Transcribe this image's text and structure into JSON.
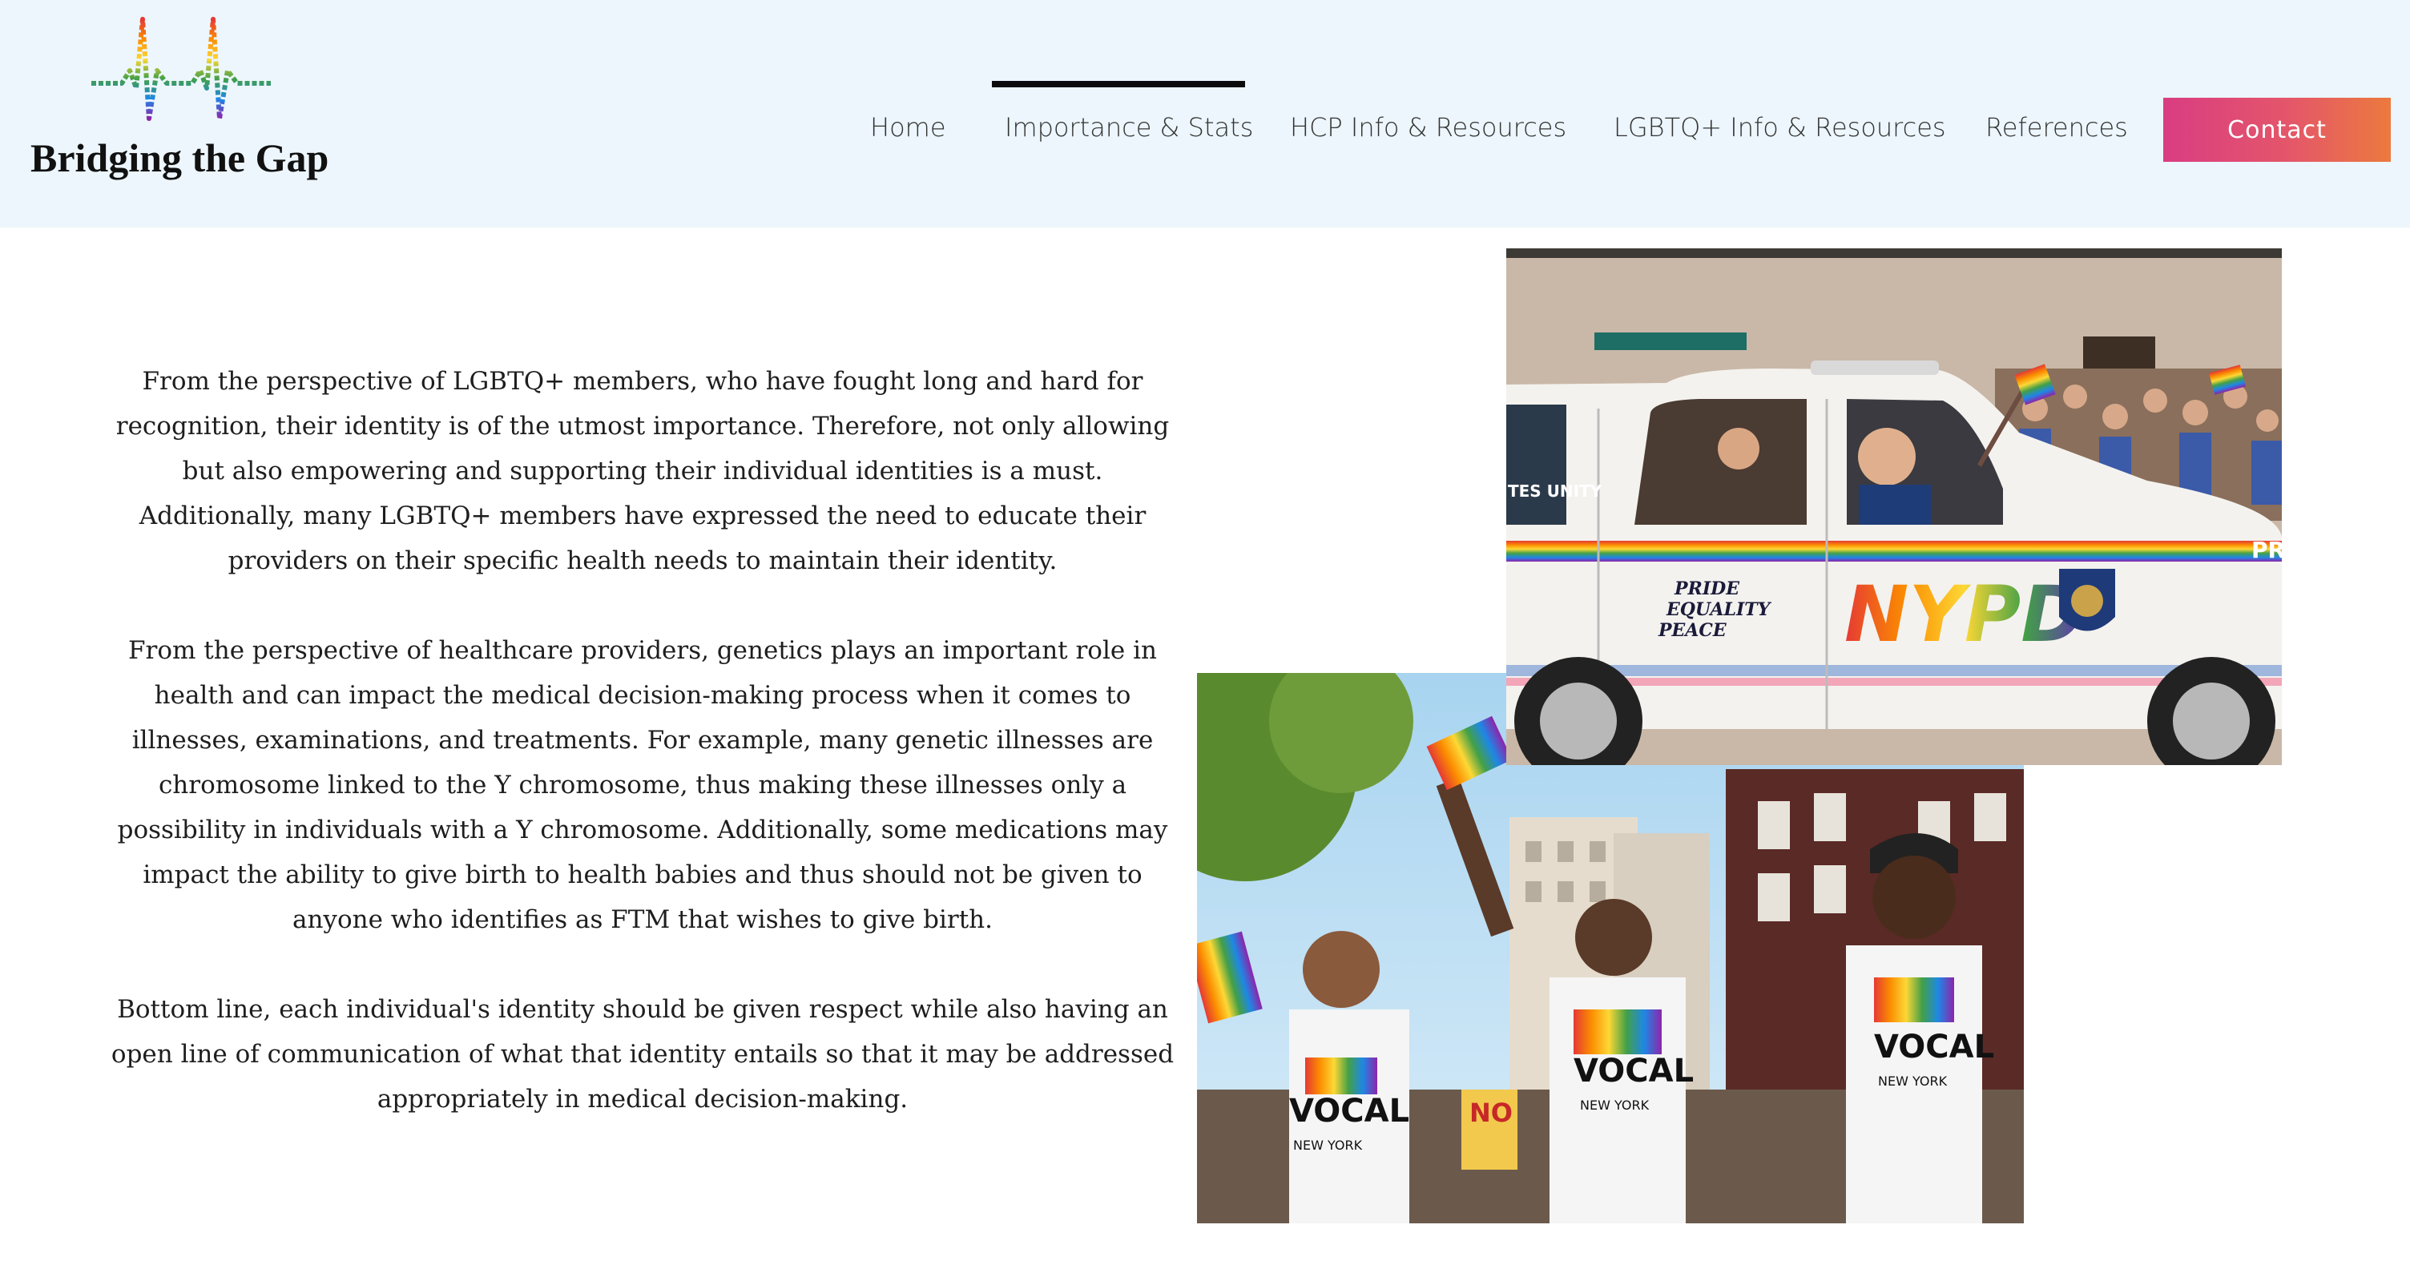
{
  "brand": {
    "name": "Bridging the Gap",
    "logo_icon": "heartbeat-rainbow-icon"
  },
  "nav": {
    "items": [
      {
        "label": "Home",
        "active": false
      },
      {
        "label": "Importance & Stats",
        "active": true
      },
      {
        "label": "HCP Info & Resources",
        "active": false
      },
      {
        "label": "LGBTQ+ Info & Resources",
        "active": false
      },
      {
        "label": "References",
        "active": false
      }
    ],
    "contact_label": "Contact"
  },
  "content": {
    "paragraphs": [
      "From the perspective of LGBTQ+ members, who have fought long and hard for recognition, their identity is of the utmost importance. Therefore, not only allowing but also empowering and supporting their individual identities is a must. Additionally, many LGBTQ+ members have expressed the need to educate their providers on their specific health needs to maintain their identity.",
      "From the perspective of healthcare providers, genetics plays an important role in health and can impact the medical decision-making process when it comes to illnesses, examinations, and treatments. For example, many genetic illnesses are chromosome linked to the Y chromosome, thus making these illnesses only a possibility in individuals with a Y chromosome. Additionally, some medications may impact the ability to give birth to health babies and thus should not be given to anyone who identifies as FTM that wishes to give birth.",
      "Bottom line, each individual's identity should be given respect while also having an open line of communication of what that identity entails so that it may be addressed appropriately in medical decision-making."
    ]
  },
  "images": {
    "car_photo": {
      "car_text": "NYPD",
      "decal_lines": [
        "PRIDE",
        "EQUALITY",
        "PEACE"
      ],
      "side_text": "TES\nUNITY",
      "rear_text": "PRI"
    },
    "parade_photo": {
      "shirt_text": "VOCAL",
      "shirt_subtext": "NEW YORK",
      "sign_text": "NO"
    }
  },
  "colors": {
    "header_bg": "#ecf6fc",
    "contact_gradient_start": "#d93d82",
    "contact_gradient_end": "#ec7a3e",
    "active_indicator": "#0c0c0c"
  }
}
